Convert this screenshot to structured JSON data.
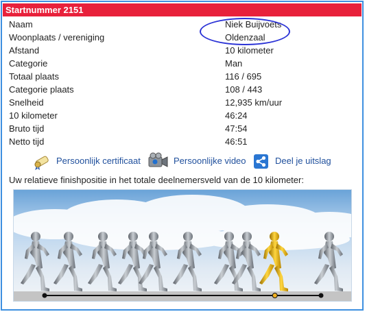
{
  "header": {
    "title": "Startnummer 2151"
  },
  "details": [
    {
      "label": "Naam",
      "value": "Niek Buijvoets"
    },
    {
      "label": "Woonplaats / vereniging",
      "value": "Oldenzaal"
    },
    {
      "label": "Afstand",
      "value": "10 kilometer"
    },
    {
      "label": "Categorie",
      "value": "Man"
    },
    {
      "label": "Totaal plaats",
      "value": "116 / 695"
    },
    {
      "label": "Categorie plaats",
      "value": "108 / 443"
    },
    {
      "label": "Snelheid",
      "value": "12,935 km/uur"
    },
    {
      "label": "10 kilometer",
      "value": "46:24"
    },
    {
      "label": "Bruto tijd",
      "value": "47:54"
    },
    {
      "label": "Netto tijd",
      "value": "46:51"
    }
  ],
  "links": {
    "certificate": "Persoonlijk certificaat",
    "video": "Persoonlijke video",
    "share": "Deel je uitslag"
  },
  "caption": "Uw relatieve finishpositie in het totale deelnemersveld van de 10 kilometer:",
  "icons": {
    "certificate": "certificate-scroll-icon",
    "video": "video-camera-icon",
    "share": "share-icon"
  },
  "colors": {
    "header": "#e8213b",
    "link": "#1f4f9c",
    "highlight_runner": "#e0b020",
    "ellipse": "#2b33d6"
  },
  "finish_position": {
    "place": 116,
    "total": 695
  }
}
